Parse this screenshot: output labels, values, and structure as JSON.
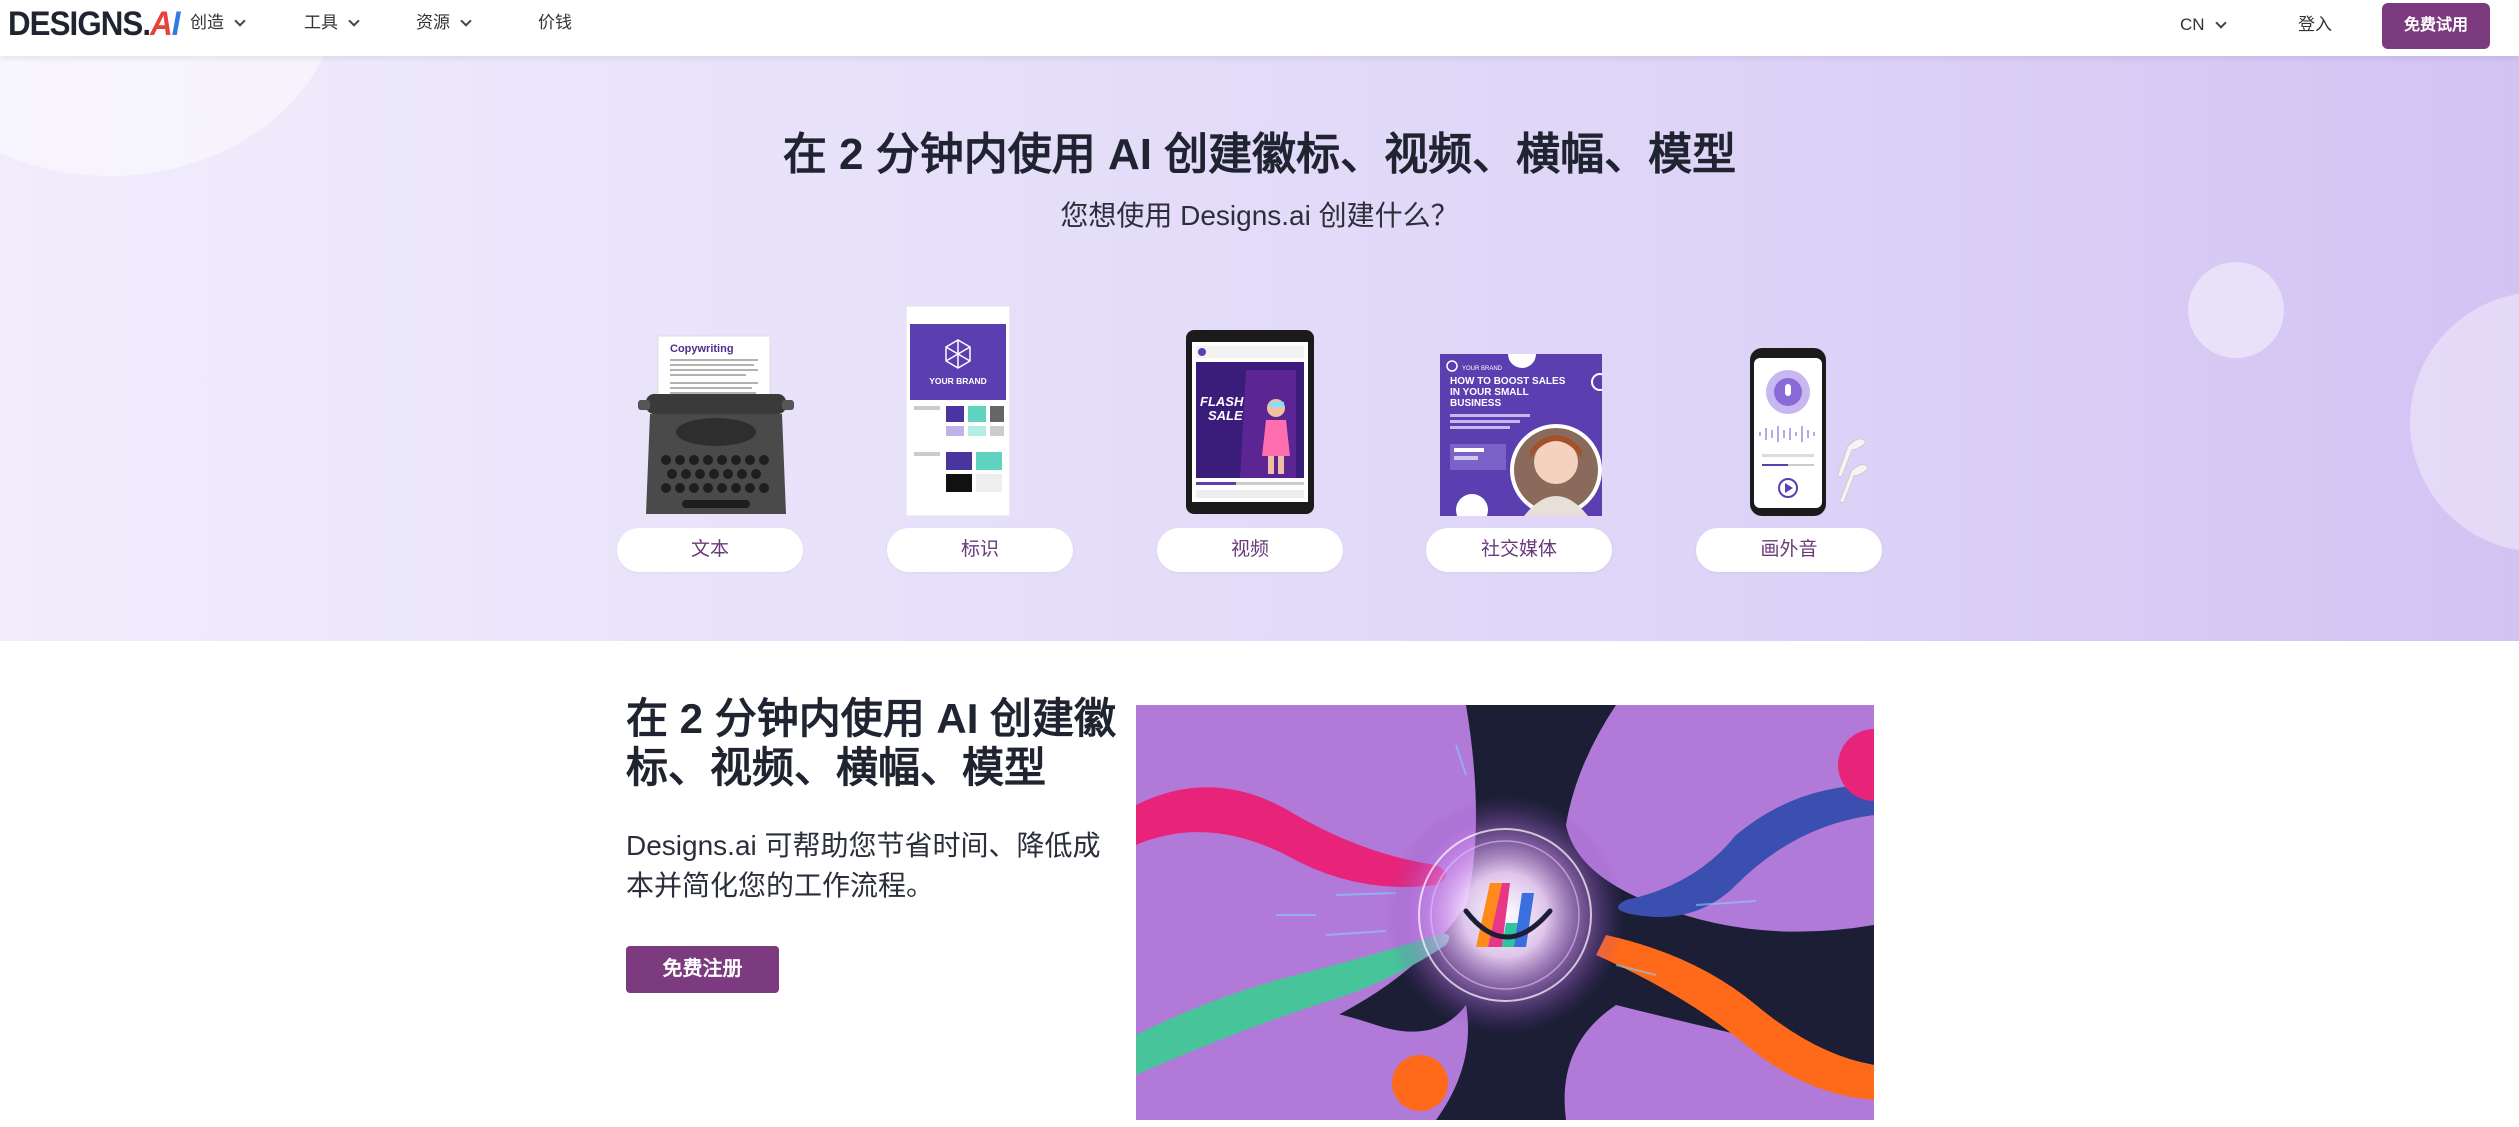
{
  "nav": {
    "logo_main": "DESIGNS.",
    "logo_a": "A",
    "logo_i": "I",
    "items": [
      {
        "label": "创造"
      },
      {
        "label": "工具"
      },
      {
        "label": "资源"
      },
      {
        "label": "价钱"
      }
    ],
    "language": "CN",
    "login": "登入",
    "trial_button": "免费试用"
  },
  "hero": {
    "title": "在 2 分钟内使用 AI 创建徽标、视频、横幅、模型",
    "subtitle": "您想使用 Designs.ai 创建什么？",
    "cards": [
      {
        "label": "文本",
        "art_text": "Copywriting",
        "icon": "typewriter-icon"
      },
      {
        "label": "标识",
        "art_text": "YOUR BRAND",
        "icon": "brand-guide-icon"
      },
      {
        "label": "视频",
        "art_text_1": "FLASH",
        "art_text_2": "SALE",
        "icon": "tablet-video-icon"
      },
      {
        "label": "社交媒体",
        "art_text": "HOW TO BOOST SALES IN YOUR SMALL BUSINESS",
        "icon": "social-post-icon"
      },
      {
        "label": "画外音",
        "icon": "phone-voiceover-icon"
      }
    ]
  },
  "section2": {
    "title": "在 2 分钟内使用 AI 创建徽标、视频、横幅、模型",
    "text": "Designs.ai 可帮助您节省时间、降低成本并简化您的工作流程。",
    "signup_button": "免费注册"
  },
  "colors": {
    "brand_purple": "#7b3b7e",
    "hero_bg_start": "#f1edfc",
    "hero_bg_end": "#d2c3f3"
  }
}
